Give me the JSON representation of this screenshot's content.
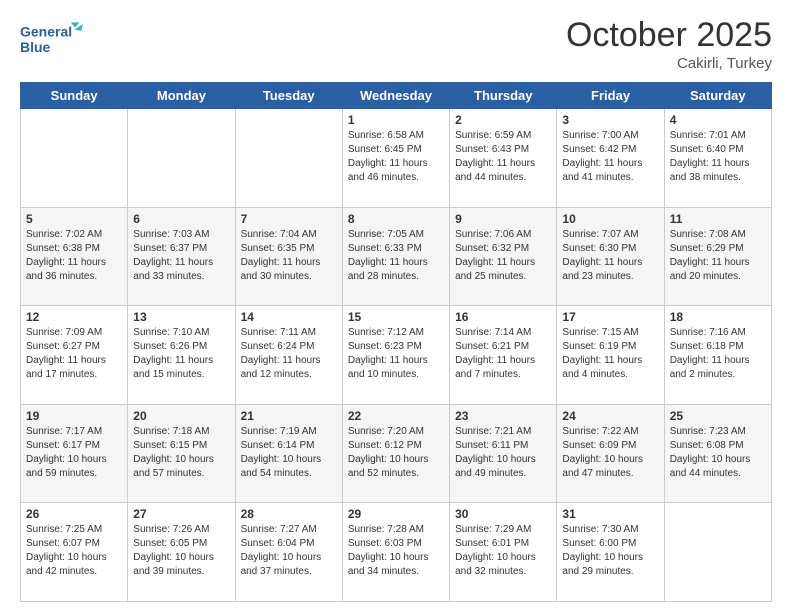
{
  "header": {
    "logo_line1": "General",
    "logo_line2": "Blue",
    "month": "October 2025",
    "location": "Cakirli, Turkey"
  },
  "days_of_week": [
    "Sunday",
    "Monday",
    "Tuesday",
    "Wednesday",
    "Thursday",
    "Friday",
    "Saturday"
  ],
  "weeks": [
    [
      {
        "num": "",
        "info": ""
      },
      {
        "num": "",
        "info": ""
      },
      {
        "num": "",
        "info": ""
      },
      {
        "num": "1",
        "info": "Sunrise: 6:58 AM\nSunset: 6:45 PM\nDaylight: 11 hours\nand 46 minutes."
      },
      {
        "num": "2",
        "info": "Sunrise: 6:59 AM\nSunset: 6:43 PM\nDaylight: 11 hours\nand 44 minutes."
      },
      {
        "num": "3",
        "info": "Sunrise: 7:00 AM\nSunset: 6:42 PM\nDaylight: 11 hours\nand 41 minutes."
      },
      {
        "num": "4",
        "info": "Sunrise: 7:01 AM\nSunset: 6:40 PM\nDaylight: 11 hours\nand 38 minutes."
      }
    ],
    [
      {
        "num": "5",
        "info": "Sunrise: 7:02 AM\nSunset: 6:38 PM\nDaylight: 11 hours\nand 36 minutes."
      },
      {
        "num": "6",
        "info": "Sunrise: 7:03 AM\nSunset: 6:37 PM\nDaylight: 11 hours\nand 33 minutes."
      },
      {
        "num": "7",
        "info": "Sunrise: 7:04 AM\nSunset: 6:35 PM\nDaylight: 11 hours\nand 30 minutes."
      },
      {
        "num": "8",
        "info": "Sunrise: 7:05 AM\nSunset: 6:33 PM\nDaylight: 11 hours\nand 28 minutes."
      },
      {
        "num": "9",
        "info": "Sunrise: 7:06 AM\nSunset: 6:32 PM\nDaylight: 11 hours\nand 25 minutes."
      },
      {
        "num": "10",
        "info": "Sunrise: 7:07 AM\nSunset: 6:30 PM\nDaylight: 11 hours\nand 23 minutes."
      },
      {
        "num": "11",
        "info": "Sunrise: 7:08 AM\nSunset: 6:29 PM\nDaylight: 11 hours\nand 20 minutes."
      }
    ],
    [
      {
        "num": "12",
        "info": "Sunrise: 7:09 AM\nSunset: 6:27 PM\nDaylight: 11 hours\nand 17 minutes."
      },
      {
        "num": "13",
        "info": "Sunrise: 7:10 AM\nSunset: 6:26 PM\nDaylight: 11 hours\nand 15 minutes."
      },
      {
        "num": "14",
        "info": "Sunrise: 7:11 AM\nSunset: 6:24 PM\nDaylight: 11 hours\nand 12 minutes."
      },
      {
        "num": "15",
        "info": "Sunrise: 7:12 AM\nSunset: 6:23 PM\nDaylight: 11 hours\nand 10 minutes."
      },
      {
        "num": "16",
        "info": "Sunrise: 7:14 AM\nSunset: 6:21 PM\nDaylight: 11 hours\nand 7 minutes."
      },
      {
        "num": "17",
        "info": "Sunrise: 7:15 AM\nSunset: 6:19 PM\nDaylight: 11 hours\nand 4 minutes."
      },
      {
        "num": "18",
        "info": "Sunrise: 7:16 AM\nSunset: 6:18 PM\nDaylight: 11 hours\nand 2 minutes."
      }
    ],
    [
      {
        "num": "19",
        "info": "Sunrise: 7:17 AM\nSunset: 6:17 PM\nDaylight: 10 hours\nand 59 minutes."
      },
      {
        "num": "20",
        "info": "Sunrise: 7:18 AM\nSunset: 6:15 PM\nDaylight: 10 hours\nand 57 minutes."
      },
      {
        "num": "21",
        "info": "Sunrise: 7:19 AM\nSunset: 6:14 PM\nDaylight: 10 hours\nand 54 minutes."
      },
      {
        "num": "22",
        "info": "Sunrise: 7:20 AM\nSunset: 6:12 PM\nDaylight: 10 hours\nand 52 minutes."
      },
      {
        "num": "23",
        "info": "Sunrise: 7:21 AM\nSunset: 6:11 PM\nDaylight: 10 hours\nand 49 minutes."
      },
      {
        "num": "24",
        "info": "Sunrise: 7:22 AM\nSunset: 6:09 PM\nDaylight: 10 hours\nand 47 minutes."
      },
      {
        "num": "25",
        "info": "Sunrise: 7:23 AM\nSunset: 6:08 PM\nDaylight: 10 hours\nand 44 minutes."
      }
    ],
    [
      {
        "num": "26",
        "info": "Sunrise: 7:25 AM\nSunset: 6:07 PM\nDaylight: 10 hours\nand 42 minutes."
      },
      {
        "num": "27",
        "info": "Sunrise: 7:26 AM\nSunset: 6:05 PM\nDaylight: 10 hours\nand 39 minutes."
      },
      {
        "num": "28",
        "info": "Sunrise: 7:27 AM\nSunset: 6:04 PM\nDaylight: 10 hours\nand 37 minutes."
      },
      {
        "num": "29",
        "info": "Sunrise: 7:28 AM\nSunset: 6:03 PM\nDaylight: 10 hours\nand 34 minutes."
      },
      {
        "num": "30",
        "info": "Sunrise: 7:29 AM\nSunset: 6:01 PM\nDaylight: 10 hours\nand 32 minutes."
      },
      {
        "num": "31",
        "info": "Sunrise: 7:30 AM\nSunset: 6:00 PM\nDaylight: 10 hours\nand 29 minutes."
      },
      {
        "num": "",
        "info": ""
      }
    ]
  ]
}
